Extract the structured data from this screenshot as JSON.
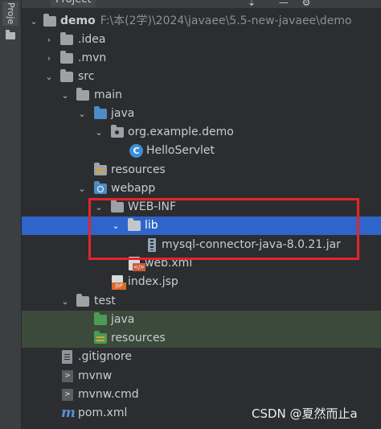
{
  "sidebar": {
    "label": "Proje"
  },
  "panel": {
    "title": "Project"
  },
  "tree": {
    "demo": {
      "name": "demo",
      "path": "F:\\本(2学)\\2024\\javaee\\5.5-new-javaee\\demo"
    },
    "idea": ".idea",
    "mvn": ".mvn",
    "src": "src",
    "main": "main",
    "java": "java",
    "package": "org.example.demo",
    "servlet": "HelloServlet",
    "resources": "resources",
    "webapp": "webapp",
    "webinf": "WEB-INF",
    "lib": "lib",
    "jar": "mysql-connector-java-8.0.21.jar",
    "webxml": "web.xml",
    "indexjsp": "index.jsp",
    "test": "test",
    "test_java": "java",
    "test_resources": "resources",
    "gitignore": ".gitignore",
    "mvnw": "mvnw",
    "mvnwcmd": "mvnw.cmd",
    "pom": "pom.xml"
  },
  "icons": {
    "class": "C",
    "shell": ">",
    "maven": "m"
  },
  "colors": {
    "selection": "#2f65ca",
    "highlight_box": "#e3252b",
    "test_source_bg": "#3c4a3c"
  },
  "watermark": "CSDN @夏然而止a"
}
